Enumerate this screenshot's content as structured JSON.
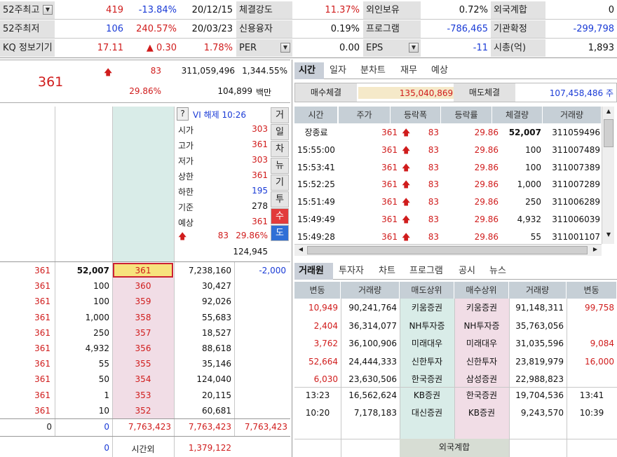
{
  "top_rows": [
    [
      {
        "l": "52주최고",
        "dd": true
      },
      {
        "v": "419",
        "c": "red"
      },
      {
        "v": "-13.84%",
        "c": "blue"
      },
      {
        "v": "20/12/15",
        "c": "blk"
      },
      {
        "l": "체결강도"
      },
      {
        "v": "11.37%",
        "c": "red"
      },
      {
        "l": "외인보유"
      },
      {
        "v": "0.72%",
        "c": "blk"
      },
      {
        "l": "외국계합"
      },
      {
        "v": "0",
        "c": "blk"
      }
    ],
    [
      {
        "l": "52주최저"
      },
      {
        "v": "106",
        "c": "blue"
      },
      {
        "v": "240.57%",
        "c": "red"
      },
      {
        "v": "20/03/23",
        "c": "blk"
      },
      {
        "l": "신용융자"
      },
      {
        "v": "0.19%",
        "c": "blk"
      },
      {
        "l": "프로그램"
      },
      {
        "v": "-786,465",
        "c": "blue"
      },
      {
        "l": "기관확정"
      },
      {
        "v": "-299,798",
        "c": "blue"
      }
    ],
    [
      {
        "l": "KQ 정보기기"
      },
      {
        "v": "17.11",
        "c": "red"
      },
      {
        "v": "▲ 0.30",
        "c": "red"
      },
      {
        "v": "1.78%",
        "c": "red"
      },
      {
        "l": "PER",
        "dd": true
      },
      {
        "v": "0.00",
        "c": "blk"
      },
      {
        "l": "EPS",
        "dd": true
      },
      {
        "v": "-11",
        "c": "blue"
      },
      {
        "l": "시총(억)"
      },
      {
        "v": "1,893",
        "c": "blk"
      }
    ]
  ],
  "price": {
    "current": "361",
    "change": "83",
    "volume": "311,059,496",
    "vol_ratio": "1,344.55%",
    "pct": "29.86%",
    "amount": "104,899",
    "amount_unit": "백만"
  },
  "info": {
    "q": "?",
    "vi": "VI 해제 10:26",
    "rows": [
      {
        "k": "시가",
        "v": "303",
        "c": "red"
      },
      {
        "k": "고가",
        "v": "361",
        "c": "red"
      },
      {
        "k": "저가",
        "v": "303",
        "c": "red"
      },
      {
        "k": "상한",
        "v": "361",
        "c": "red"
      },
      {
        "k": "하한",
        "v": "195",
        "c": "blue"
      },
      {
        "k": "기준",
        "v": "278",
        "c": "blk"
      },
      {
        "k": "예상",
        "v": "361",
        "c": "red"
      }
    ],
    "exp_change": "83",
    "exp_pct": "29.86%",
    "exp_vol": "124,945"
  },
  "side_buttons": [
    "거",
    "일",
    "차",
    "뉴",
    "기",
    "투",
    "수",
    "도"
  ],
  "book": [
    {
      "a": "361",
      "b": "52,007",
      "p": "361",
      "q": "7,238,160",
      "d": "-2,000"
    },
    {
      "a": "361",
      "b": "100",
      "p": "360",
      "q": "30,427",
      "d": ""
    },
    {
      "a": "361",
      "b": "100",
      "p": "359",
      "q": "92,026",
      "d": ""
    },
    {
      "a": "361",
      "b": "1,000",
      "p": "358",
      "q": "55,683",
      "d": ""
    },
    {
      "a": "361",
      "b": "250",
      "p": "357",
      "q": "18,527",
      "d": ""
    },
    {
      "a": "361",
      "b": "4,932",
      "p": "356",
      "q": "88,618",
      "d": ""
    },
    {
      "a": "361",
      "b": "55",
      "p": "355",
      "q": "35,146",
      "d": ""
    },
    {
      "a": "361",
      "b": "50",
      "p": "354",
      "q": "124,040",
      "d": ""
    },
    {
      "a": "361",
      "b": "1",
      "p": "353",
      "q": "20,115",
      "d": ""
    },
    {
      "a": "361",
      "b": "10",
      "p": "352",
      "q": "60,681",
      "d": ""
    }
  ],
  "book_total": {
    "a": "0",
    "b": "0",
    "c": "7,763,423",
    "d": "7,763,423",
    "e": "7,763,423"
  },
  "book_after": {
    "b": "0",
    "label": "시간외",
    "q": "1,379,122"
  },
  "time_tabs": [
    "시간",
    "일자",
    "분차트",
    "재무",
    "예상"
  ],
  "exec": {
    "buy_label": "매수체결",
    "buy": "135,040,869 주",
    "sell_label": "매도체결",
    "sell": "107,458,486 주"
  },
  "time_headers": [
    "시간",
    "주가",
    "등락폭",
    "등락률",
    "체결량",
    "거래량"
  ],
  "time_rows": [
    {
      "t": "장종료",
      "p": "361",
      "ch": "83",
      "r": "29.86",
      "q": "52,007",
      "v": "311059496",
      "bold": true
    },
    {
      "t": "15:55:00",
      "p": "361",
      "ch": "83",
      "r": "29.86",
      "q": "100",
      "v": "311007489"
    },
    {
      "t": "15:53:41",
      "p": "361",
      "ch": "83",
      "r": "29.86",
      "q": "100",
      "v": "311007389"
    },
    {
      "t": "15:52:25",
      "p": "361",
      "ch": "83",
      "r": "29.86",
      "q": "1,000",
      "v": "311007289"
    },
    {
      "t": "15:51:49",
      "p": "361",
      "ch": "83",
      "r": "29.86",
      "q": "250",
      "v": "311006289"
    },
    {
      "t": "15:49:49",
      "p": "361",
      "ch": "83",
      "r": "29.86",
      "q": "4,932",
      "v": "311006039"
    },
    {
      "t": "15:49:28",
      "p": "361",
      "ch": "83",
      "r": "29.86",
      "q": "55",
      "v": "311001107"
    }
  ],
  "broker_tabs": [
    "거래원",
    "투자자",
    "차트",
    "프로그램",
    "공시",
    "뉴스"
  ],
  "broker_headers": [
    "변동",
    "거래량",
    "매도상위",
    "매수상위",
    "거래량",
    "변동"
  ],
  "broker_rows": [
    {
      "sc": "10,949",
      "sv": "90,241,764",
      "sn": "키움증권",
      "bn": "키움증권",
      "bv": "91,148,311",
      "bc": "99,758"
    },
    {
      "sc": "2,404",
      "sv": "36,314,077",
      "sn": "NH투자증",
      "bn": "NH투자증",
      "bv": "35,763,056",
      "bc": ""
    },
    {
      "sc": "3,762",
      "sv": "36,100,906",
      "sn": "미래대우",
      "bn": "미래대우",
      "bv": "31,035,596",
      "bc": "9,084"
    },
    {
      "sc": "52,664",
      "sv": "24,444,333",
      "sn": "신한투자",
      "bn": "신한투자",
      "bv": "23,819,979",
      "bc": "16,000"
    },
    {
      "sc": "6,030",
      "sv": "23,630,506",
      "sn": "한국증권",
      "bn": "삼성증권",
      "bv": "22,988,823",
      "bc": ""
    }
  ],
  "broker_time_rows": [
    {
      "t1": "13:23",
      "v1": "16,562,624",
      "n1": "KB증권",
      "n2": "한국증권",
      "v2": "19,704,536",
      "t2": "13:41"
    },
    {
      "t1": "10:20",
      "v1": "7,178,183",
      "n1": "대신증권",
      "n2": "KB증권",
      "v2": "9,243,570",
      "t2": "10:39"
    }
  ],
  "foreign_label": "외국계합",
  "colors": {
    "up": "#d01c1c",
    "down": "#1a3bd6",
    "sell_col": "#f1dde6",
    "buy_col": "#d9ece8"
  }
}
